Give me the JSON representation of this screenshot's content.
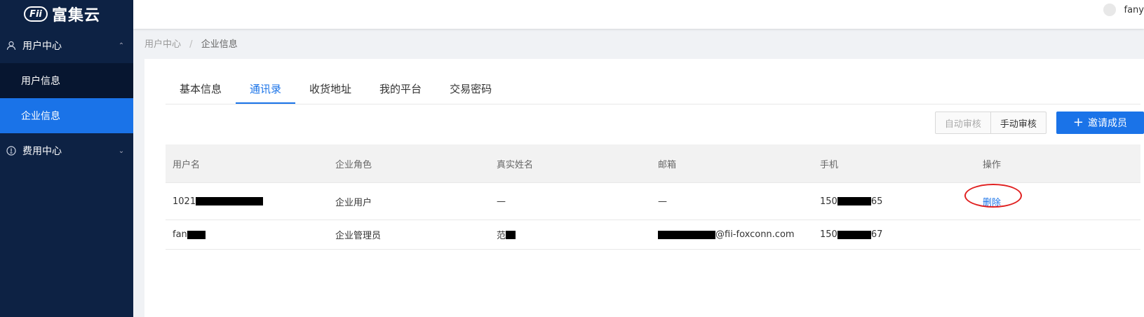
{
  "brand": {
    "logo_mark": "Fii",
    "name": "富集云"
  },
  "sidebar": {
    "groups": [
      {
        "label": "用户中心",
        "icon": "user-icon",
        "expanded": true,
        "items": [
          {
            "label": "用户信息"
          },
          {
            "label": "企业信息",
            "active": true
          }
        ]
      },
      {
        "label": "费用中心",
        "icon": "bulb-icon",
        "expanded": false
      }
    ]
  },
  "header": {
    "username": "fany"
  },
  "breadcrumb": {
    "root": "用户中心",
    "separator": "/",
    "current": "企业信息"
  },
  "tabs": [
    {
      "label": "基本信息"
    },
    {
      "label": "通讯录",
      "active": true
    },
    {
      "label": "收货地址"
    },
    {
      "label": "我的平台"
    },
    {
      "label": "交易密码"
    }
  ],
  "toolbar": {
    "auto_review": "自动审核",
    "manual_review": "手动审核",
    "invite_member": "邀请成员"
  },
  "table": {
    "columns": [
      "用户名",
      "企业角色",
      "真实姓名",
      "邮箱",
      "手机",
      "操作"
    ],
    "rows": [
      {
        "username": "1021",
        "role": "企业用户",
        "real_name": "—",
        "email": "—",
        "phone_prefix": "150",
        "phone_suffix": "65",
        "action": "删除"
      },
      {
        "username": "fan",
        "role": "企业管理员",
        "real_name": "范",
        "email_suffix": "@fii-foxconn.com",
        "phone_prefix": "150",
        "phone_suffix": "67"
      }
    ]
  },
  "colors": {
    "accent": "#1a73e8",
    "sidebar_bg": "#0d2244",
    "annotation": "#e02020"
  }
}
